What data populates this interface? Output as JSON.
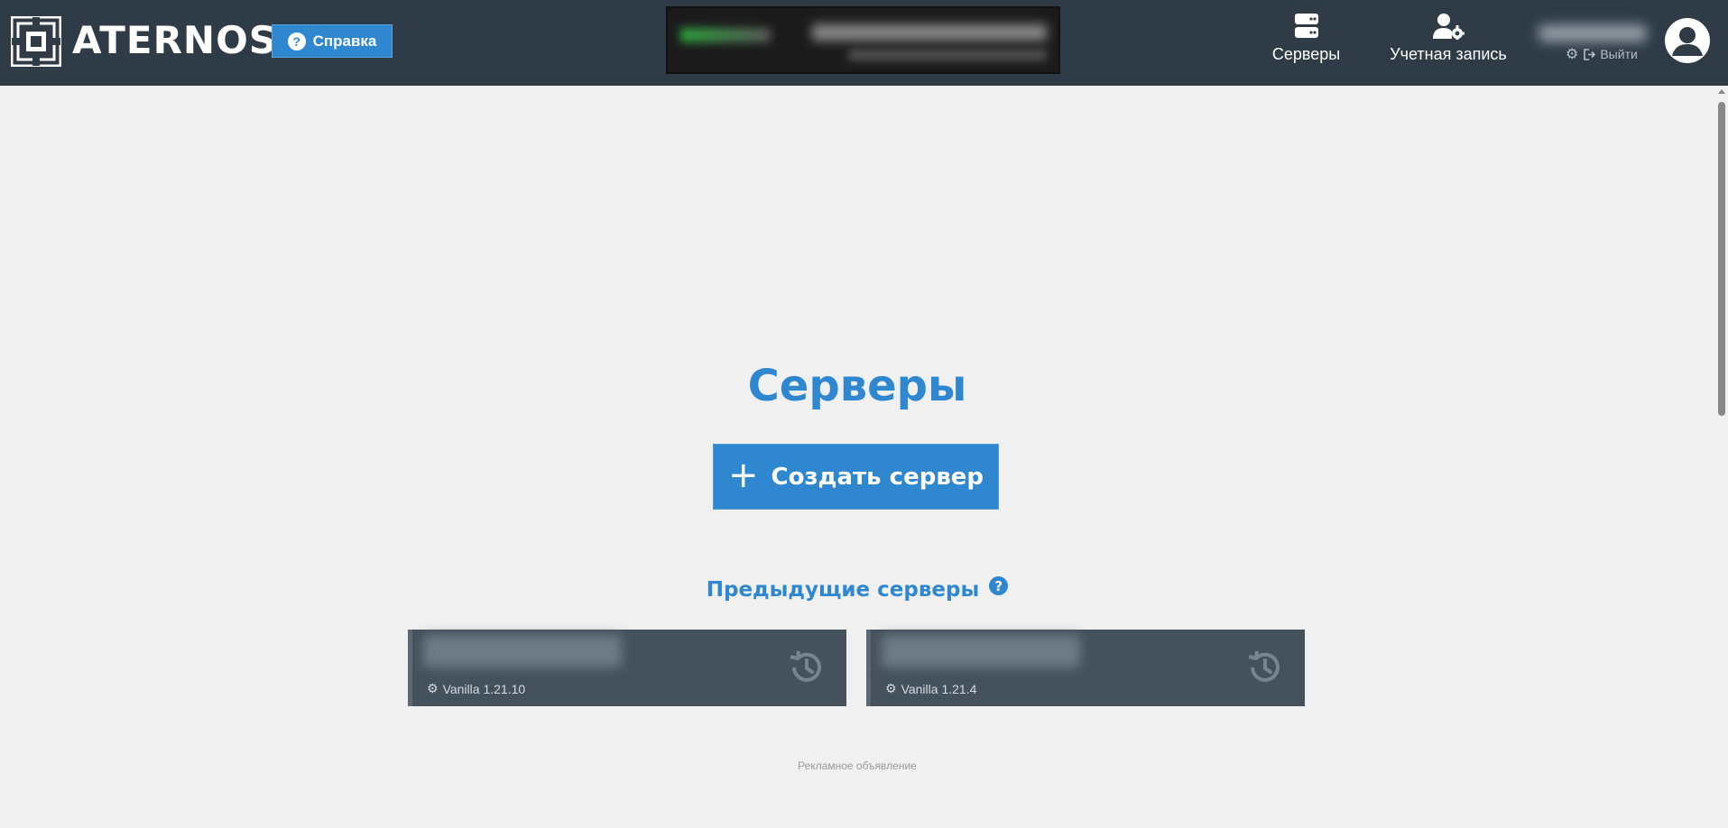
{
  "header": {
    "brand": "ATERNOS",
    "help_button": "Справка",
    "nav": {
      "servers": "Серверы",
      "account": "Учетная запись"
    },
    "logout": "Выйти"
  },
  "main": {
    "title": "Серверы",
    "create_button": "Создать сервер",
    "previous_title": "Предыдущие серверы",
    "servers": [
      {
        "version": "Vanilla 1.21.10"
      },
      {
        "version": "Vanilla 1.21.4"
      }
    ],
    "ad_label": "Рекламное объявление"
  },
  "colors": {
    "header_bg": "#2f3b46",
    "accent": "#2f87d0",
    "card_bg": "#45515c",
    "page_bg": "#f0f0f0"
  },
  "icons": {
    "logo": "aternos-logo-icon",
    "help": "question-circle-icon",
    "servers": "server-stack-icon",
    "account": "user-gear-icon",
    "settings": "gear-icon",
    "logout": "sign-out-icon",
    "avatar": "user-avatar-icon",
    "create": "plus-icon",
    "history": "history-icon"
  }
}
